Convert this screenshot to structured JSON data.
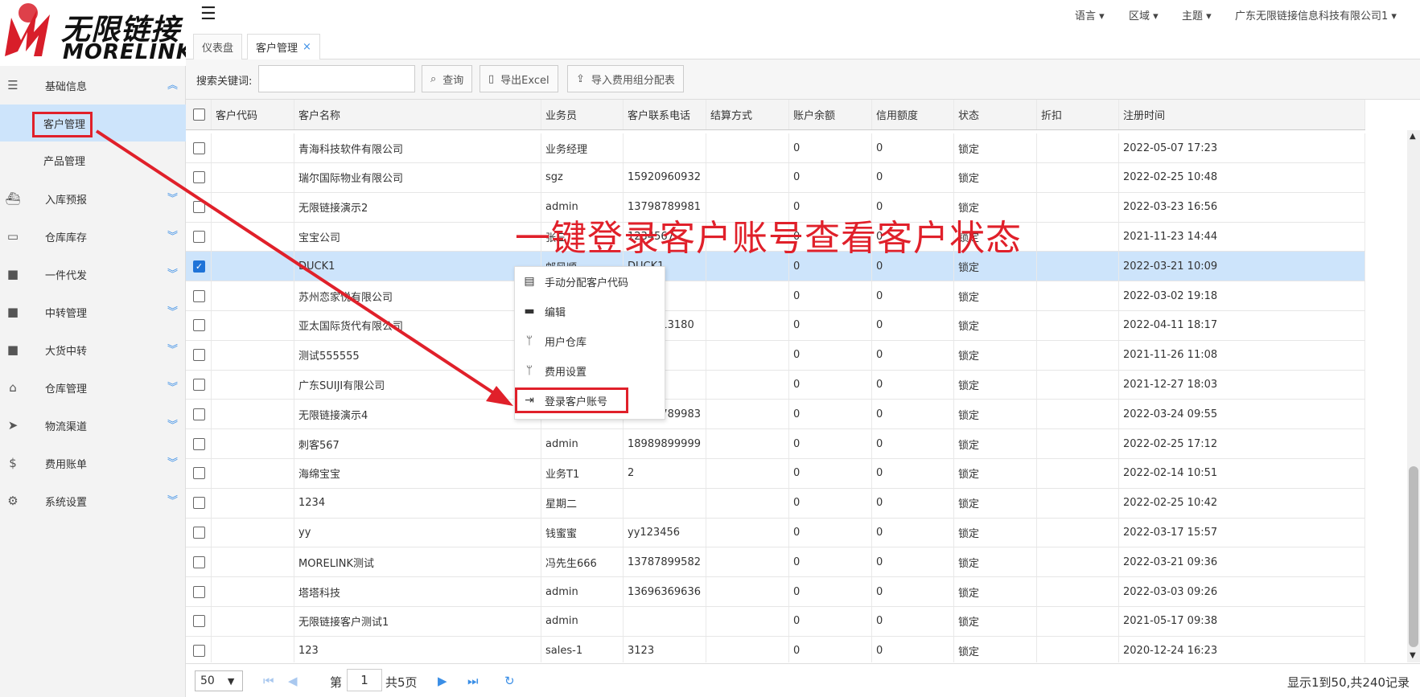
{
  "brand": {
    "name_cn": "无限链接",
    "name_en": "MORELINK"
  },
  "topbar": {
    "menus": [
      "语言",
      "区域",
      "主题",
      "广东无限链接信息科技有限公司1"
    ]
  },
  "tabs": [
    {
      "label": "仪表盘"
    },
    {
      "label": "客户管理",
      "close": "×"
    }
  ],
  "sidebar": {
    "items": [
      {
        "label": "基础信息",
        "icon": "list-icon"
      },
      {
        "label": "入库预报",
        "icon": "ship-icon"
      },
      {
        "label": "仓库库存",
        "icon": "inbox-icon"
      },
      {
        "label": "一件代发",
        "icon": "truck-icon"
      },
      {
        "label": "中转管理",
        "icon": "truck-icon"
      },
      {
        "label": "大货中转",
        "icon": "truck-icon"
      },
      {
        "label": "仓库管理",
        "icon": "home-icon"
      },
      {
        "label": "物流渠道",
        "icon": "cursor-icon"
      },
      {
        "label": "费用账单",
        "icon": "dollar-icon"
      },
      {
        "label": "系统设置",
        "icon": "gear-icon"
      }
    ],
    "sub": [
      {
        "label": "客户管理"
      },
      {
        "label": "产品管理"
      }
    ]
  },
  "toolbar": {
    "search_label": "搜索关键词:",
    "search_value": "",
    "query_label": "查询",
    "export_label": "导出Excel",
    "import_label": "导入费用组分配表"
  },
  "table": {
    "columns": [
      "客户代码",
      "客户名称",
      "业务员",
      "客户联系电话",
      "结算方式",
      "账户余额",
      "信用额度",
      "状态",
      "折扣",
      "注册时间"
    ],
    "rows": [
      {
        "name": "青海科技软件有限公司",
        "sales": "业务经理",
        "phone": "",
        "balance": "0",
        "credit": "0",
        "status": "锁定",
        "time": "2022-05-07 17:23"
      },
      {
        "name": "瑞尔国际物业有限公司",
        "sales": "sgz",
        "phone": "15920960932",
        "balance": "0",
        "credit": "0",
        "status": "锁定",
        "time": "2022-02-25 10:48"
      },
      {
        "name": "无限链接演示2",
        "sales": "admin",
        "phone": "13798789981",
        "balance": "0",
        "credit": "0",
        "status": "锁定",
        "time": "2022-03-23 16:56"
      },
      {
        "name": "宝宝公司",
        "sales": "张三",
        "phone": "1234567",
        "balance": "0",
        "credit": "0",
        "status": "锁定",
        "time": "2021-11-23 14:44"
      },
      {
        "name": "DUCK1",
        "sales": "邮风顺",
        "phone": "DUCK1",
        "balance": "0",
        "credit": "0",
        "status": "锁定",
        "time": "2022-03-21 10:09"
      },
      {
        "name": "苏州恋家悦有限公司",
        "sales": "",
        "phone": "",
        "balance": "0",
        "credit": "0",
        "status": "锁定",
        "time": "2022-03-02 19:18"
      },
      {
        "name": "亚太国际货代有限公司",
        "sales": "",
        "phone": "3731313180",
        "balance": "0",
        "credit": "0",
        "status": "锁定",
        "time": "2022-04-11 18:17"
      },
      {
        "name": "测试555555",
        "sales": "",
        "phone": "",
        "balance": "0",
        "credit": "0",
        "status": "锁定",
        "time": "2021-11-26 11:08"
      },
      {
        "name": "广东SUIJI有限公司",
        "sales": "",
        "phone": "",
        "balance": "0",
        "credit": "0",
        "status": "锁定",
        "time": "2021-12-27 18:03"
      },
      {
        "name": "无限链接演示4",
        "sales": "",
        "phone": "13798789983",
        "balance": "0",
        "credit": "0",
        "status": "锁定",
        "time": "2022-03-24 09:55"
      },
      {
        "name": "刺客567",
        "sales": "admin",
        "phone": "18989899999",
        "balance": "0",
        "credit": "0",
        "status": "锁定",
        "time": "2022-02-25 17:12"
      },
      {
        "name": "海绵宝宝",
        "sales": "业务T1",
        "phone": "2",
        "balance": "0",
        "credit": "0",
        "status": "锁定",
        "time": "2022-02-14 10:51"
      },
      {
        "name": "1234",
        "sales": "星期二",
        "phone": "",
        "balance": "0",
        "credit": "0",
        "status": "锁定",
        "time": "2022-02-25 10:42"
      },
      {
        "name": "yy",
        "sales": "钱蜜蜜",
        "phone": "yy123456",
        "balance": "0",
        "credit": "0",
        "status": "锁定",
        "time": "2022-03-17 15:57"
      },
      {
        "name": "MORELINK测试",
        "sales": "冯先生666",
        "phone": "13787899582",
        "balance": "0",
        "credit": "0",
        "status": "锁定",
        "time": "2022-03-21 09:36"
      },
      {
        "name": "塔塔科技",
        "sales": "admin",
        "phone": "13696369636",
        "balance": "0",
        "credit": "0",
        "status": "锁定",
        "time": "2022-03-03 09:26"
      },
      {
        "name": "无限链接客户测试1",
        "sales": "admin",
        "phone": "",
        "balance": "0",
        "credit": "0",
        "status": "锁定",
        "time": "2021-05-17 09:38"
      },
      {
        "name": "123",
        "sales": "sales-1",
        "phone": "3123",
        "balance": "0",
        "credit": "0",
        "status": "锁定",
        "time": "2020-12-24 16:23"
      }
    ]
  },
  "context_menu": {
    "items": [
      {
        "label": "手动分配客户代码",
        "icon": "id-card-icon"
      },
      {
        "label": "编辑",
        "icon": "credit-card-icon"
      },
      {
        "label": "用户仓库",
        "icon": "branch-icon"
      },
      {
        "label": "费用设置",
        "icon": "branch-icon"
      },
      {
        "label": "登录客户账号",
        "icon": "sign-in-icon"
      }
    ]
  },
  "footer": {
    "page_size": "50",
    "page_prefix": "第",
    "page": "1",
    "page_suffix": "共5页",
    "summary": "显示1到50,共240记录"
  },
  "annotation": {
    "text": "一键登录客户账号查看客户状态"
  },
  "colors": {
    "accent": "#3a8ee6",
    "annotation": "#e0202a",
    "selected_row": "#cde4fb"
  }
}
